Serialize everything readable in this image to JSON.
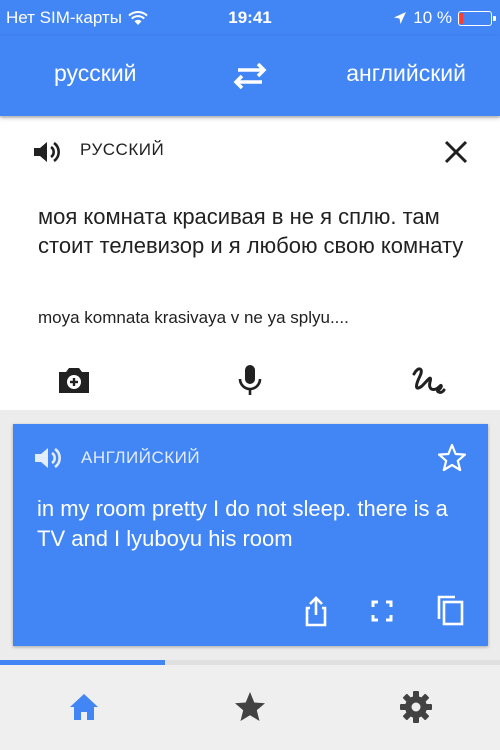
{
  "status_bar": {
    "carrier": "Нет SIM-карты",
    "time": "19:41",
    "battery": "10 %",
    "battery_level": 0.1,
    "battery_color": "#ff3b30"
  },
  "language_bar": {
    "source_language": "русский",
    "target_language": "английский",
    "swap_icon": "swap-arrows-icon"
  },
  "source": {
    "language_label": "РУССКИЙ",
    "text": "моя комната красивая в не я сплю. там стоит телевизор и я любою свою комнату",
    "transliteration": "moya komnata krasivaya v ne ya splyu....",
    "tools": [
      "camera-icon",
      "microphone-icon",
      "handwriting-icon"
    ]
  },
  "translation": {
    "language_label": "АНГЛИЙСКИЙ",
    "text": "in my room pretty I do not sleep. there is a TV and I lyuboyu his room",
    "tools": [
      "share-icon",
      "fullscreen-icon",
      "copy-icon"
    ]
  },
  "progress": {
    "fraction": 0.33
  },
  "tabs": [
    "home-icon",
    "star-icon",
    "settings-icon"
  ],
  "colors": {
    "accent": "#4285f4",
    "card": "#ffffff",
    "background": "#ececec"
  }
}
